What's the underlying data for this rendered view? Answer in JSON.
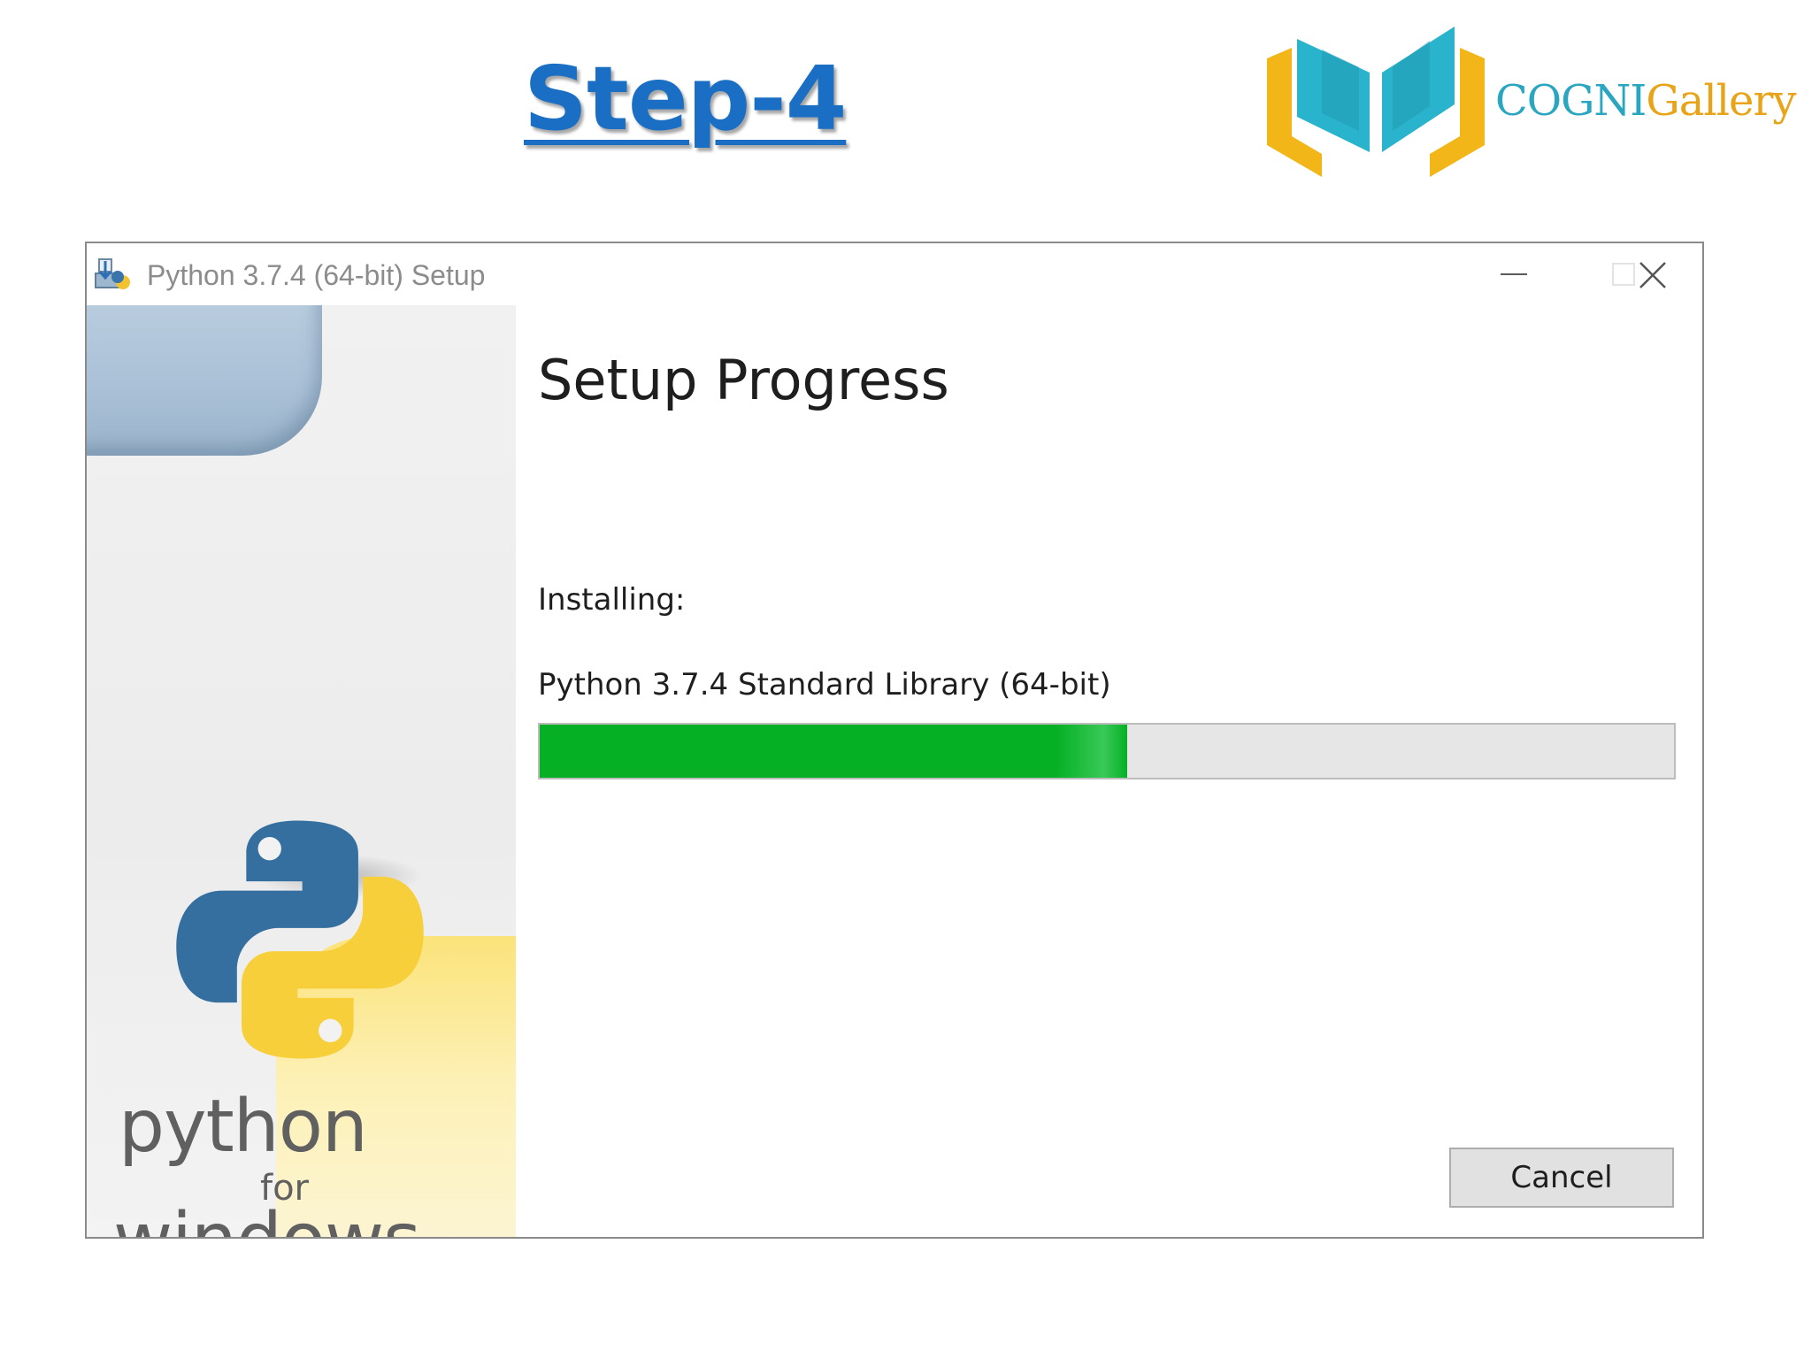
{
  "slide": {
    "step_title": "Step-4",
    "brand": {
      "name_part1": "COGNI",
      "name_part2": "Gallery",
      "logo_icon": "open-book-icon",
      "colors": {
        "teal": "#2aa6c0",
        "gold": "#e8a317"
      }
    }
  },
  "window": {
    "title": "Python 3.7.4 (64-bit) Setup",
    "title_icon": "installer-icon",
    "controls": [
      "minimize",
      "maximize",
      "close"
    ]
  },
  "side_art": {
    "logo_icon": "python-logo-icon",
    "text_python": "python",
    "text_for": "for",
    "text_windows": "windows"
  },
  "content": {
    "heading": "Setup Progress",
    "status_label": "Installing:",
    "current_package": "Python 3.7.4 Standard Library (64-bit)",
    "progress_percent": 51.8,
    "progress_color": "#06b025",
    "cancel_label": "Cancel"
  }
}
